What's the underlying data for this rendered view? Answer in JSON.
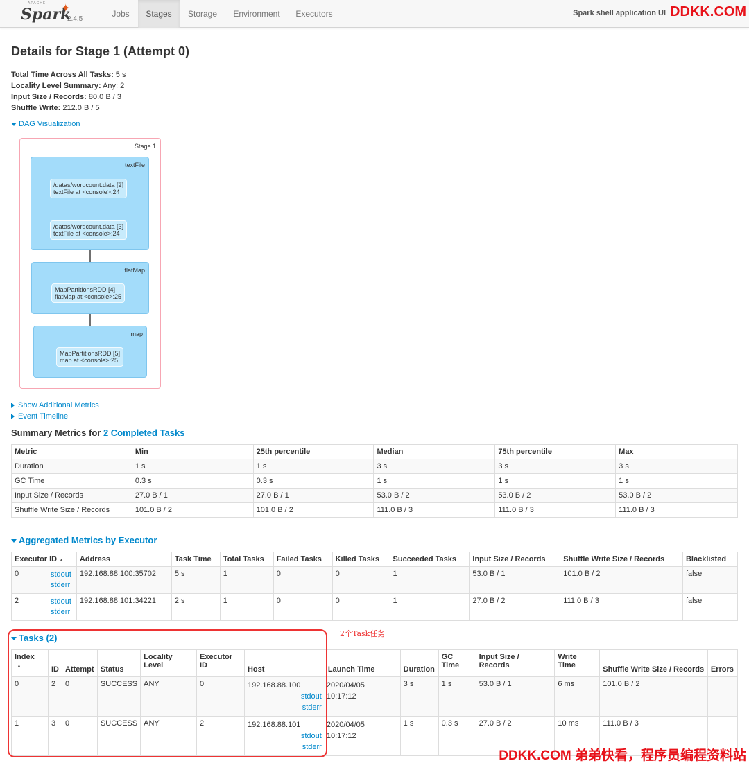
{
  "nav": {
    "apache": "APACHE",
    "brand": "Spark",
    "version": "2.4.5",
    "tabs": [
      "Jobs",
      "Stages",
      "Storage",
      "Environment",
      "Executors"
    ],
    "app_name": "Spark shell application UI"
  },
  "watermark_top": "DDKK.COM",
  "page_title": "Details for Stage 1 (Attempt 0)",
  "summary": [
    {
      "label": "Total Time Across All Tasks:",
      "value": "5 s"
    },
    {
      "label": "Locality Level Summary:",
      "value": "Any: 2"
    },
    {
      "label": "Input Size / Records:",
      "value": "80.0 B / 3"
    },
    {
      "label": "Shuffle Write:",
      "value": "212.0 B / 5"
    }
  ],
  "dag": {
    "toggle": "DAG Visualization",
    "stage_label": "Stage 1",
    "clusters": [
      {
        "label": "textFile",
        "rdds": [
          {
            "line1": "/datas/wordcount.data [2]",
            "line2": "textFile at <console>:24"
          },
          {
            "line1": "/datas/wordcount.data [3]",
            "line2": "textFile at <console>:24"
          }
        ]
      },
      {
        "label": "flatMap",
        "rdds": [
          {
            "line1": "MapPartitionsRDD [4]",
            "line2": "flatMap at <console>:25"
          }
        ]
      },
      {
        "label": "map",
        "rdds": [
          {
            "line1": "MapPartitionsRDD [5]",
            "line2": "map at <console>:25"
          }
        ]
      }
    ]
  },
  "links": {
    "additional_metrics": "Show Additional Metrics",
    "event_timeline": "Event Timeline"
  },
  "summary_metrics": {
    "title_prefix": "Summary Metrics for ",
    "title_link": "2 Completed Tasks",
    "headers": [
      "Metric",
      "Min",
      "25th percentile",
      "Median",
      "75th percentile",
      "Max"
    ],
    "rows": [
      [
        "Duration",
        "1 s",
        "1 s",
        "3 s",
        "3 s",
        "3 s"
      ],
      [
        "GC Time",
        "0.3 s",
        "0.3 s",
        "1 s",
        "1 s",
        "1 s"
      ],
      [
        "Input Size / Records",
        "27.0 B / 1",
        "27.0 B / 1",
        "53.0 B / 2",
        "53.0 B / 2",
        "53.0 B / 2"
      ],
      [
        "Shuffle Write Size / Records",
        "101.0 B / 2",
        "101.0 B / 2",
        "111.0 B / 3",
        "111.0 B / 3",
        "111.0 B / 3"
      ]
    ]
  },
  "aggregated": {
    "title": "Aggregated Metrics by Executor",
    "headers": [
      "Executor ID",
      "Address",
      "Task Time",
      "Total Tasks",
      "Failed Tasks",
      "Killed Tasks",
      "Succeeded Tasks",
      "Input Size / Records",
      "Shuffle Write Size / Records",
      "Blacklisted"
    ],
    "sort_icon": "▲",
    "rows": [
      {
        "id": "0",
        "stdout": "stdout",
        "stderr": "stderr",
        "address": "192.168.88.100:35702",
        "task_time": "5 s",
        "total": "1",
        "failed": "0",
        "killed": "0",
        "succeeded": "1",
        "input": "53.0 B / 1",
        "shuffle": "101.0 B / 2",
        "blacklisted": "false"
      },
      {
        "id": "2",
        "stdout": "stdout",
        "stderr": "stderr",
        "address": "192.168.88.101:34221",
        "task_time": "2 s",
        "total": "1",
        "failed": "0",
        "killed": "0",
        "succeeded": "1",
        "input": "27.0 B / 2",
        "shuffle": "111.0 B / 3",
        "blacklisted": "false"
      }
    ]
  },
  "tasks": {
    "title": "Tasks (2)",
    "annotation": "2个Task任务",
    "headers": {
      "index": "Index",
      "id": "ID",
      "attempt": "Attempt",
      "status": "Status",
      "locality_1": "Locality",
      "locality_2": "Level",
      "executor_1": "Executor",
      "executor_2": "ID",
      "host": "Host",
      "launch": "Launch Time",
      "duration": "Duration",
      "gc_1": "GC",
      "gc_2": "Time",
      "input_1": "Input Size /",
      "input_2": "Records",
      "write_1": "Write",
      "write_2": "Time",
      "shuffle": "Shuffle Write Size / Records",
      "errors": "Errors"
    },
    "rows": [
      {
        "index": "0",
        "id": "2",
        "attempt": "0",
        "status": "SUCCESS",
        "locality": "ANY",
        "executor": "0",
        "host": "192.168.88.100",
        "stdout": "stdout",
        "stderr": "stderr",
        "launch_1": "2020/04/05",
        "launch_2": "10:17:12",
        "duration": "3 s",
        "gc": "1 s",
        "input": "53.0 B / 1",
        "write": "6 ms",
        "shuffle": "101.0 B / 2",
        "errors": ""
      },
      {
        "index": "1",
        "id": "3",
        "attempt": "0",
        "status": "SUCCESS",
        "locality": "ANY",
        "executor": "2",
        "host": "192.168.88.101",
        "stdout": "stdout",
        "stderr": "stderr",
        "launch_1": "2020/04/05",
        "launch_2": "10:17:12",
        "duration": "1 s",
        "gc": "0.3 s",
        "input": "27.0 B / 2",
        "write": "10 ms",
        "shuffle": "111.0 B / 3",
        "errors": ""
      }
    ]
  },
  "watermark_bottom": "DDKK.COM 弟弟快看，程序员编程资料站"
}
